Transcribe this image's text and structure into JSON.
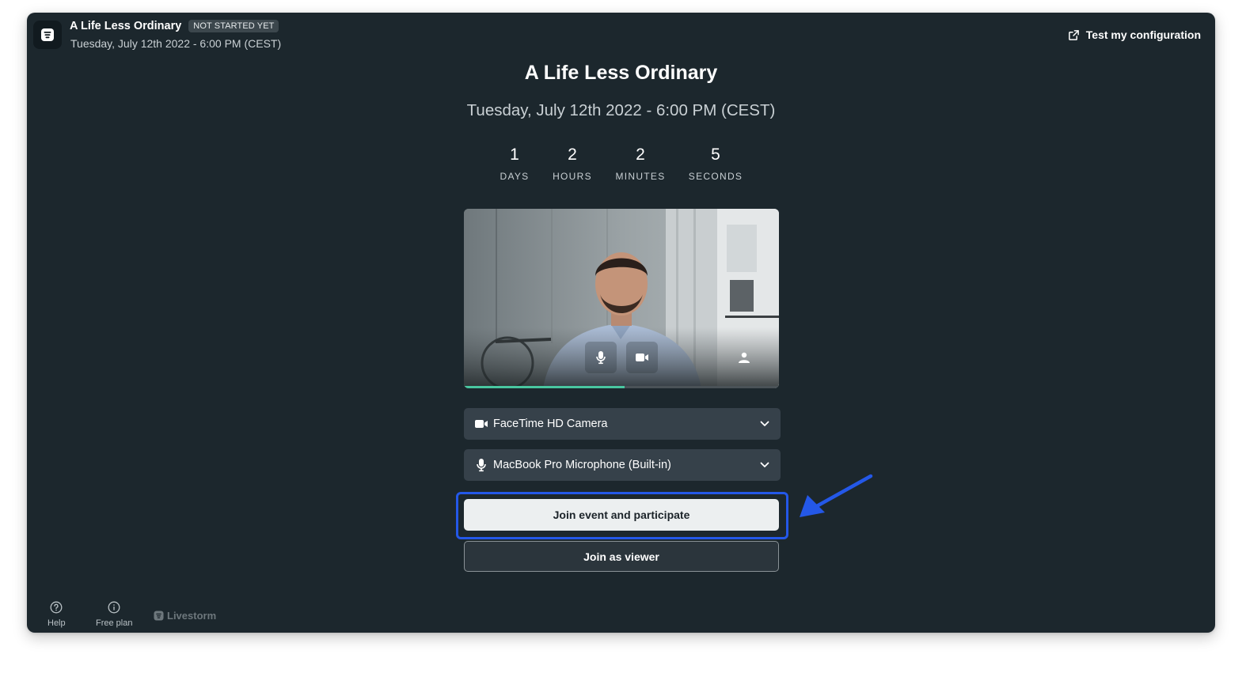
{
  "header": {
    "title": "A Life Less Ordinary",
    "status_badge": "NOT STARTED YET",
    "date": "Tuesday, July 12th 2022 - 6:00 PM (CEST)",
    "test_config_label": "Test my configuration"
  },
  "event": {
    "title": "A Life Less Ordinary",
    "date": "Tuesday, July 12th 2022 - 6:00 PM (CEST)"
  },
  "countdown": [
    {
      "value": "1",
      "label": "DAYS"
    },
    {
      "value": "2",
      "label": "HOURS"
    },
    {
      "value": "2",
      "label": "MINUTES"
    },
    {
      "value": "5",
      "label": "SECONDS"
    }
  ],
  "preview": {
    "mic_level": 0.51,
    "accent_color": "#49c7a0"
  },
  "devices": {
    "camera": "FaceTime HD Camera",
    "microphone": "MacBook Pro Microphone (Built-in)"
  },
  "buttons": {
    "join_participate": "Join event and participate",
    "join_viewer": "Join as viewer"
  },
  "footer": {
    "help": "Help",
    "free_plan": "Free plan",
    "brand": "Livestorm"
  },
  "colors": {
    "background": "#1c272d",
    "highlight": "#2458e8"
  }
}
